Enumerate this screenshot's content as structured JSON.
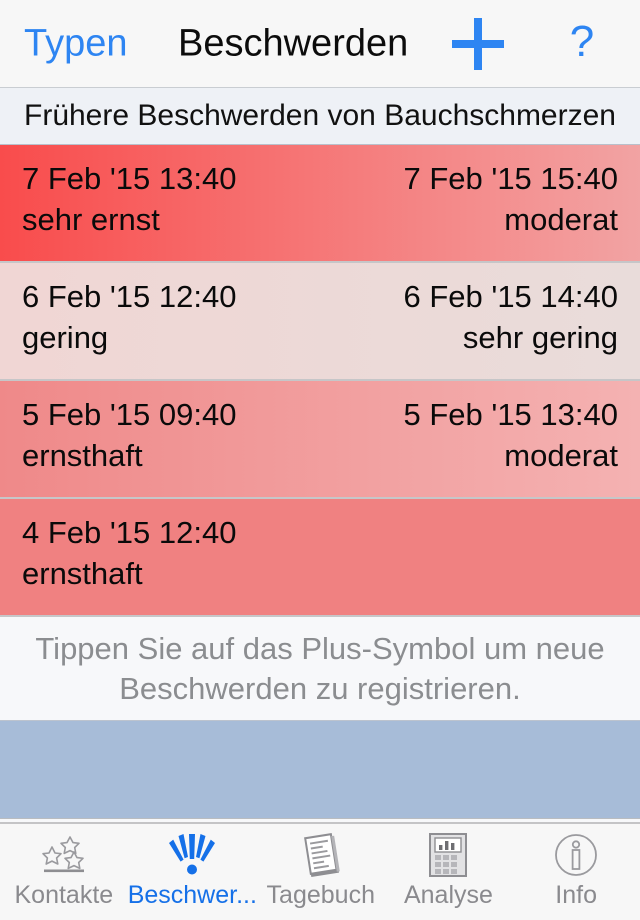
{
  "navbar": {
    "back_label": "Typen",
    "title": "Beschwerden",
    "add_icon": "plus-icon",
    "add_label": "+",
    "help_label": "?",
    "accent_color": "#2e85f2"
  },
  "section": {
    "header": "Frühere Beschwerden von Bauchschmerzen"
  },
  "list": {
    "rows": [
      {
        "start_time": "7 Feb '15 13:40",
        "start_severity": "sehr ernst",
        "end_time": "7 Feb '15 15:40",
        "end_severity": "moderat",
        "color_start": "#f94c4c",
        "color_end": "#f2a3a3"
      },
      {
        "start_time": "6 Feb '15 12:40",
        "start_severity": "gering",
        "end_time": "6 Feb '15 14:40",
        "end_severity": "sehr gering",
        "color_start": "#f0d6d4",
        "color_end": "#e9dcda"
      },
      {
        "start_time": "5 Feb '15 09:40",
        "start_severity": "ernsthaft",
        "end_time": "5 Feb '15 13:40",
        "end_severity": "moderat",
        "color_start": "#ef8989",
        "color_end": "#f4b2b2"
      },
      {
        "start_time": "4 Feb '15 12:40",
        "start_severity": "ernsthaft",
        "end_time": "",
        "end_severity": "",
        "color_start": "#f08181",
        "color_end": "#f08181"
      }
    ]
  },
  "hint": {
    "line1": "Tippen Sie auf das Plus-Symbol um neue",
    "line2": "Beschwerden zu registrieren."
  },
  "blue_block": {
    "color": "#a7bcd8"
  },
  "tabbar": {
    "tabs": [
      {
        "label": "Kontakte",
        "icon": "stars-icon",
        "active": false
      },
      {
        "label": "Beschwer...",
        "icon": "exclamation-burst-icon",
        "active": true
      },
      {
        "label": "Tagebuch",
        "icon": "notepad-icon",
        "active": false
      },
      {
        "label": "Analyse",
        "icon": "calculator-icon",
        "active": false
      },
      {
        "label": "Info",
        "icon": "info-circle-icon",
        "active": false
      }
    ],
    "active_color": "#1570e8",
    "inactive_color": "#8a8a8e"
  }
}
